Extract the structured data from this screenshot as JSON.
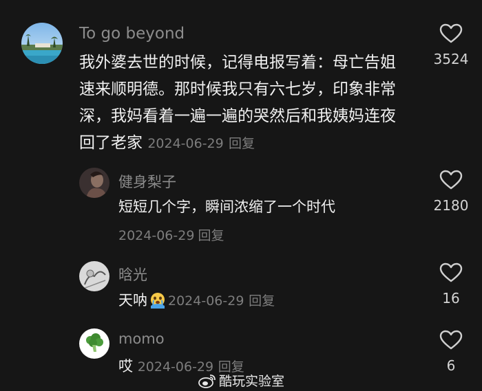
{
  "comments": [
    {
      "username": "To go beyond",
      "text": "我外婆去世的时候，记得电报写着：母亡告姐速来顺明德。那时候我只有六七岁，印象非常深，我妈看着一遍一遍的哭然后和我姨妈连夜回了老家",
      "date": "2024-06-29",
      "reply_label": "回复",
      "likes": "3524",
      "avatar_icon": "pool-resort-avatar"
    },
    {
      "username": "健身梨子",
      "text": "短短几个字，瞬间浓缩了一个时代",
      "date": "2024-06-29",
      "reply_label": "回复",
      "likes": "2180",
      "avatar_icon": "person-avatar"
    },
    {
      "username": "晗光",
      "text": "天呐",
      "date": "2024-06-29",
      "reply_label": "回复",
      "likes": "16",
      "avatar_icon": "sketch-avatar",
      "emoji": "crying-face-emoji"
    },
    {
      "username": "momo",
      "text": "哎",
      "date": "2024-06-29",
      "reply_label": "回复",
      "likes": "6",
      "avatar_icon": "broccoli-avatar"
    }
  ],
  "watermark": {
    "text": "酷玩实验室",
    "icon": "weibo-icon"
  },
  "colors": {
    "background": "#161616",
    "username": "#8c8c8c",
    "text": "#f0f0f0",
    "meta": "#7d7d7d"
  }
}
